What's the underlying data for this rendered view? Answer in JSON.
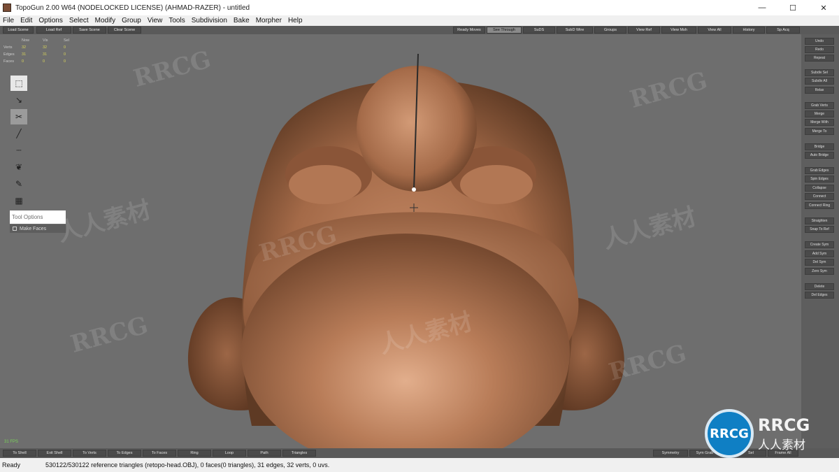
{
  "window": {
    "title": "TopoGun 2.00 W64  (NODELOCKED LICENSE) (AHMAD-RAZER) - untitled",
    "minimize": "—",
    "maximize": "☐",
    "close": "✕"
  },
  "menu": [
    "File",
    "Edit",
    "Options",
    "Select",
    "Modify",
    "Group",
    "View",
    "Tools",
    "Subdivision",
    "Bake",
    "Morpher",
    "Help"
  ],
  "top_toolbar": {
    "left": [
      "Load Scene",
      "Load Ref",
      "Save Scene",
      "Clear Scene"
    ],
    "right": [
      "Ready Moves",
      "See Through",
      "SuDS",
      "SubD Wire",
      "Groups",
      "View Ref",
      "View Msh",
      "View All",
      "History",
      "Sp Acq"
    ]
  },
  "stats": {
    "headers": [
      "Now",
      "Vis",
      "Sel"
    ],
    "rows": [
      {
        "label": "Verts",
        "values": [
          "32",
          "32",
          "0"
        ]
      },
      {
        "label": "Edges",
        "values": [
          "31",
          "31",
          "0"
        ]
      },
      {
        "label": "Faces",
        "values": [
          "0",
          "0",
          "0"
        ]
      }
    ]
  },
  "left_tools": [
    {
      "icon": "select-icon",
      "glyph": "⬚"
    },
    {
      "icon": "move-icon",
      "glyph": "↘"
    },
    {
      "icon": "cut-icon",
      "glyph": "✂"
    },
    {
      "icon": "draw-icon",
      "glyph": "╱"
    },
    {
      "icon": "bridge-icon",
      "glyph": "┄"
    },
    {
      "icon": "brush-icon",
      "glyph": "❦"
    },
    {
      "icon": "pen-icon",
      "glyph": "✎"
    },
    {
      "icon": "grid-icon",
      "glyph": "▦"
    }
  ],
  "tool_options": {
    "title": "Tool Options",
    "make_faces": "Make Faces"
  },
  "fps": "31 FPS",
  "right_panel": [
    "Undo",
    "Redo",
    "Repeat",
    "Subdiv Sel",
    "Subdiv All",
    "Relax",
    "Grab Verts",
    "Merge",
    "Merge With",
    "Merge To",
    "Bridge",
    "Auto Bridge",
    "Grab Edges",
    "Spin Edges",
    "Collapse",
    "Connect",
    "Connect Ring",
    "Straighten",
    "Snap To Ref",
    "Create Sym",
    "Add Sym",
    "Del Sym",
    "Zero Sym",
    "Delete",
    "Del Edges"
  ],
  "bottom_toolbar": {
    "left": [
      "To Shell",
      "Exit Shell",
      "To Verts",
      "To Edges",
      "To Faces",
      "Ring",
      "Loop",
      "Path",
      "Triangles"
    ],
    "right": [
      "Symmetry",
      "Sym Grab",
      "Sel",
      "Frame All"
    ]
  },
  "status": {
    "ready": "Ready",
    "message": "530122/530122 reference triangles (retopo-head.OBJ), 0 faces(0 triangles), 31 edges, 32 verts, 0 uvs."
  },
  "watermark": {
    "latin": "RRCG",
    "cjk": "人人素材"
  },
  "colors": {
    "skin": "#b07250",
    "viewport": "#6e6e6e",
    "accent": "#0f7fc4"
  }
}
